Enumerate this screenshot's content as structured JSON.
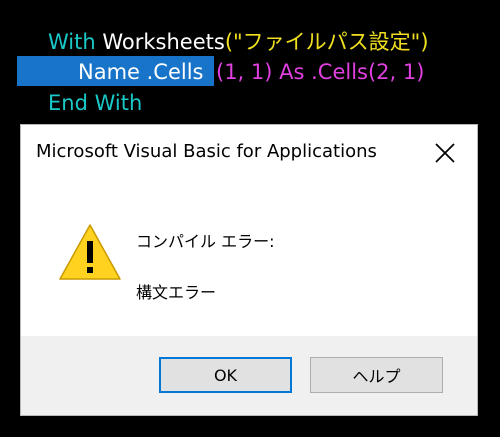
{
  "editor": {
    "line1": {
      "keyword": "With",
      "object": "Worksheets",
      "argument": "(\"ファイルパス設定\")"
    },
    "line2": {
      "selected": "Name .Cells",
      "rest": "(1, 1) As .Cells(2, 1)"
    },
    "line3": {
      "keyword": "End With"
    }
  },
  "dialog": {
    "title": "Microsoft Visual Basic for Applications",
    "close_icon": "close-icon",
    "warning_icon": "warning-icon",
    "message_heading": "コンパイル エラー:",
    "message_detail": "構文エラー",
    "ok_label": "OK",
    "help_label": "ヘルプ"
  },
  "colors": {
    "keyword": "#19c9c9",
    "string": "#f0e020",
    "magenta": "#e040e0",
    "selection": "#1874c8",
    "accent": "#0078d7"
  }
}
